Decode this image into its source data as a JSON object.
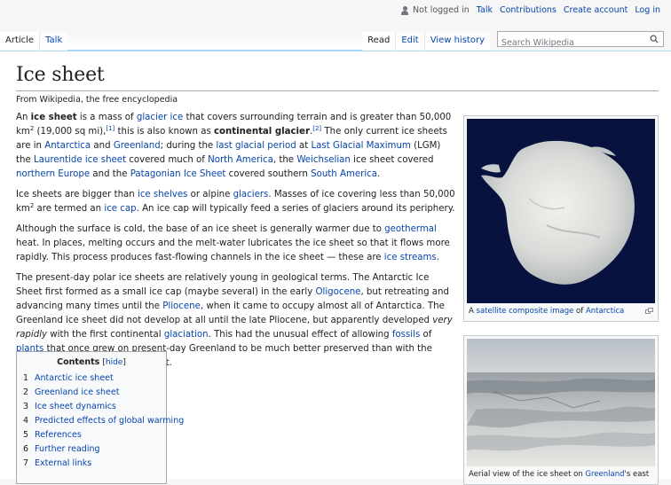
{
  "personal": {
    "not_logged_in": "Not logged in",
    "talk": "Talk",
    "contributions": "Contributions",
    "create_account": "Create account",
    "log_in": "Log in"
  },
  "tabs": {
    "article": "Article",
    "talk": "Talk",
    "read": "Read",
    "edit": "Edit",
    "view_history": "View history"
  },
  "search": {
    "placeholder": "Search Wikipedia"
  },
  "page": {
    "title": "Ice sheet",
    "tagline": "From Wikipedia, the free encyclopedia"
  },
  "para1": {
    "t1": "An ",
    "b1": "ice sheet",
    "t2": " is a mass of ",
    "l1": "glacier ice",
    "t3": " that covers surrounding terrain and is greater than 50,000 km",
    "sup1": "2",
    "t4": " (19,000 sq mi),",
    "ref1": "[1]",
    "t5": " this is also known as ",
    "b2": "continental glacier",
    "t6": ".",
    "ref2": "[2]",
    "t7": " The only current ice sheets are in ",
    "l2": "Antarctica",
    "t8": " and ",
    "l3": "Greenland",
    "t9": "; during the ",
    "l4": "last glacial period",
    "t10": " at ",
    "l5": "Last Glacial Maximum",
    "t11": " (LGM) the ",
    "l6": "Laurentide ice sheet",
    "t12": " covered much of ",
    "l7": "North America",
    "t13": ", the ",
    "l8": "Weichselian",
    "t14": " ice sheet covered ",
    "l9": "northern Europe",
    "t15": " and the ",
    "l10": "Patagonian Ice Sheet",
    "t16": " covered southern ",
    "l11": "South America",
    "t17": "."
  },
  "para2": {
    "t1": "Ice sheets are bigger than ",
    "l1": "ice shelves",
    "t2": " or alpine ",
    "l2": "glaciers",
    "t3": ". Masses of ice covering less than 50,000 km",
    "sup1": "2",
    "t4": " are termed an ",
    "l3": "ice cap",
    "t5": ". An ice cap will typically feed a series of glaciers around its periphery."
  },
  "para3": {
    "t1": "Although the surface is cold, the base of an ice sheet is generally warmer due to ",
    "l1": "geothermal",
    "t2": " heat. In places, melting occurs and the melt-water lubricates the ice sheet so that it flows more rapidly. This process produces fast-flowing channels in the ice sheet — these are ",
    "l2": "ice streams",
    "t3": "."
  },
  "para4": {
    "t1": "The present-day polar ice sheets are relatively young in geological terms. The Antarctic Ice Sheet first formed as a small ice cap (maybe several) in the early ",
    "l1": "Oligocene",
    "t2": ", but retreating and advancing many times until the ",
    "l2": "Pliocene",
    "t3": ", when it came to occupy almost all of Antarctica. The Greenland ice sheet did not develop at all until the late Pliocene, but apparently developed ",
    "i1": "very rapidly",
    "t4": " with the first continental ",
    "l3": "glaciation",
    "t5": ". This had the unusual effect of allowing ",
    "l4": "fossils",
    "t6": " of ",
    "l5": "plants",
    "t7": " that once grew on present-day Greenland to be much better preserved than with the slowly forming Antarctic ice sheet."
  },
  "toc": {
    "title": "Contents",
    "hide_open": "[",
    "hide": "hide",
    "hide_close": "]",
    "items": [
      {
        "num": "1",
        "label": "Antarctic ice sheet"
      },
      {
        "num": "2",
        "label": "Greenland ice sheet"
      },
      {
        "num": "3",
        "label": "Ice sheet dynamics"
      },
      {
        "num": "4",
        "label": "Predicted effects of global warming"
      },
      {
        "num": "5",
        "label": "References"
      },
      {
        "num": "6",
        "label": "Further reading"
      },
      {
        "num": "7",
        "label": "External links"
      }
    ]
  },
  "thumb1": {
    "cap_t1": "A ",
    "cap_l1": "satellite composite image",
    "cap_t2": " of ",
    "cap_l2": "Antarctica"
  },
  "thumb2": {
    "cap_t1": "Aerial view of the ice sheet on ",
    "cap_l1": "Greenland",
    "cap_t2": "'s east"
  },
  "colors": {
    "link": "#0645ad",
    "text": "#202122",
    "border": "#a2a9b1",
    "tab_border": "#a7d7f9"
  }
}
